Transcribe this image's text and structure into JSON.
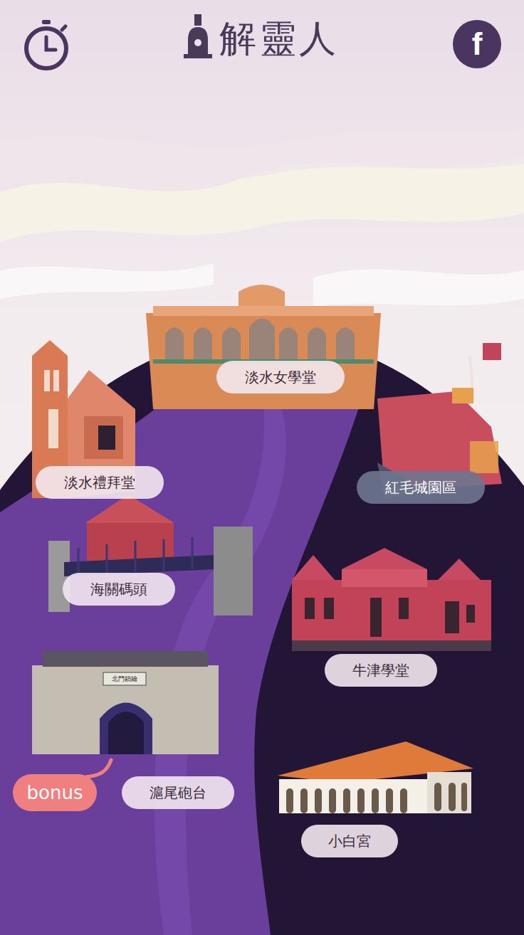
{
  "header": {
    "logo": "解靈人",
    "facebook_icon": "f"
  },
  "locations": [
    {
      "label": "淡水女學堂",
      "selected": false
    },
    {
      "label": "淡水禮拜堂",
      "selected": false
    },
    {
      "label": "紅毛城園區",
      "selected": true
    },
    {
      "label": "海關碼頭",
      "selected": false
    },
    {
      "label": "牛津學堂",
      "selected": false
    },
    {
      "label": "滬尾砲台",
      "selected": false
    },
    {
      "label": "小白宮",
      "selected": false
    }
  ],
  "bonus": "bonus",
  "gate_sign": "北門鎖鑰"
}
